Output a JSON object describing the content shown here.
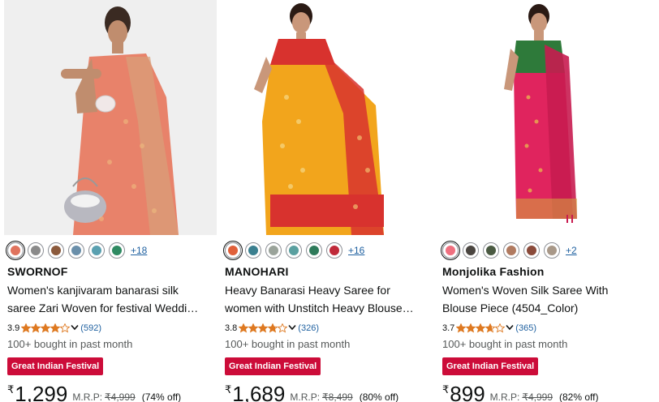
{
  "products": [
    {
      "brand": "SWORNOF",
      "title_line1": "Women's kanjivaram banarasi silk",
      "title_line2": "saree Zari Woven for festival Weddi…",
      "rating": "3.9",
      "stars": 3.9,
      "review_count": "(592)",
      "bought": "100+ bought in past month",
      "deal_badge": "Great Indian Festival",
      "currency_symbol": "₹",
      "price": "1,299",
      "mrp_label": "M.R.P:",
      "mrp": "₹4,999",
      "discount": "(74% off)",
      "more_colors": "+18",
      "swatches": [
        "#e0735e",
        "#8a8a8a",
        "#8b5a3c",
        "#6a8faa",
        "#5aa0b0",
        "#2f8a62"
      ],
      "image": {
        "primary": "#e8826a",
        "accent": "#d9a07a",
        "bg": "#eeeeee"
      }
    },
    {
      "brand": "MANOHARI",
      "title_line1": "Heavy Banarasi Heavy Saree for",
      "title_line2": "women with Unstitch Heavy Blouse…",
      "rating": "3.8",
      "stars": 3.8,
      "review_count": "(326)",
      "bought": "100+ bought in past month",
      "deal_badge": "Great Indian Festival",
      "currency_symbol": "₹",
      "price": "1,689",
      "mrp_label": "M.R.P:",
      "mrp": "₹8,499",
      "discount": "(80% off)",
      "more_colors": "+16",
      "swatches": [
        "#e0603a",
        "#3a7f8f",
        "#9aa39a",
        "#5aa0a0",
        "#2e7a5a",
        "#c02a3a"
      ],
      "image": {
        "primary": "#f2a51c",
        "accent": "#d8322e",
        "bg": "#ffffff"
      }
    },
    {
      "brand": "Monjolika Fashion",
      "title_line1": "Women's Woven Silk Saree With",
      "title_line2": "Blouse Piece (4504_Color)",
      "rating": "3.7",
      "stars": 3.7,
      "review_count": "(365)",
      "bought": "100+ bought in past month",
      "deal_badge": "Great Indian Festival",
      "currency_symbol": "₹",
      "price": "899",
      "mrp_label": "M.R.P:",
      "mrp": "₹4,999",
      "discount": "(82% off)",
      "more_colors": "+2",
      "swatches": [
        "#f07080",
        "#4a4540",
        "#4a5a42",
        "#b07a60",
        "#8a4a3a",
        "#a89888"
      ],
      "image": {
        "primary": "#e0245e",
        "accent": "#2e7a3a",
        "bg": "#ffffff"
      }
    }
  ],
  "colors": {
    "badge": "#cc0c39",
    "link": "#2162a1",
    "star": "#de7921",
    "muted": "#565959",
    "text": "#0f1111"
  }
}
